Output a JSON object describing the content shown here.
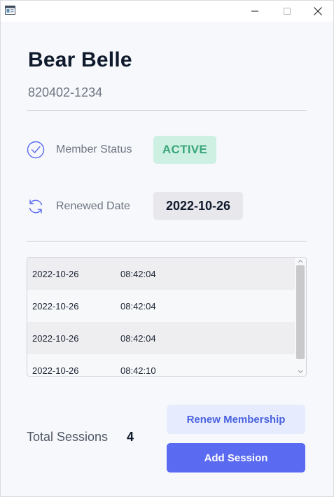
{
  "member": {
    "name": "Bear Belle",
    "id": "820402-1234"
  },
  "status": {
    "label": "Member Status",
    "value": "ACTIVE",
    "icon": "check-circle-icon",
    "color": "#3aa57a"
  },
  "renewal": {
    "label": "Renewed Date",
    "value": "2022-10-26",
    "icon": "refresh-icon"
  },
  "sessions": [
    {
      "date": "2022-10-26",
      "time": "08:42:04"
    },
    {
      "date": "2022-10-26",
      "time": "08:42:04"
    },
    {
      "date": "2022-10-26",
      "time": "08:42:04"
    },
    {
      "date": "2022-10-26",
      "time": "08:42:10"
    }
  ],
  "totals": {
    "label": "Total Sessions",
    "value": "4"
  },
  "actions": {
    "renew_label": "Renew Membership",
    "add_label": "Add Session"
  },
  "colors": {
    "accent": "#5a6bf1",
    "accent_light": "#e6ecfd",
    "active_bg": "#cdf0e2"
  }
}
